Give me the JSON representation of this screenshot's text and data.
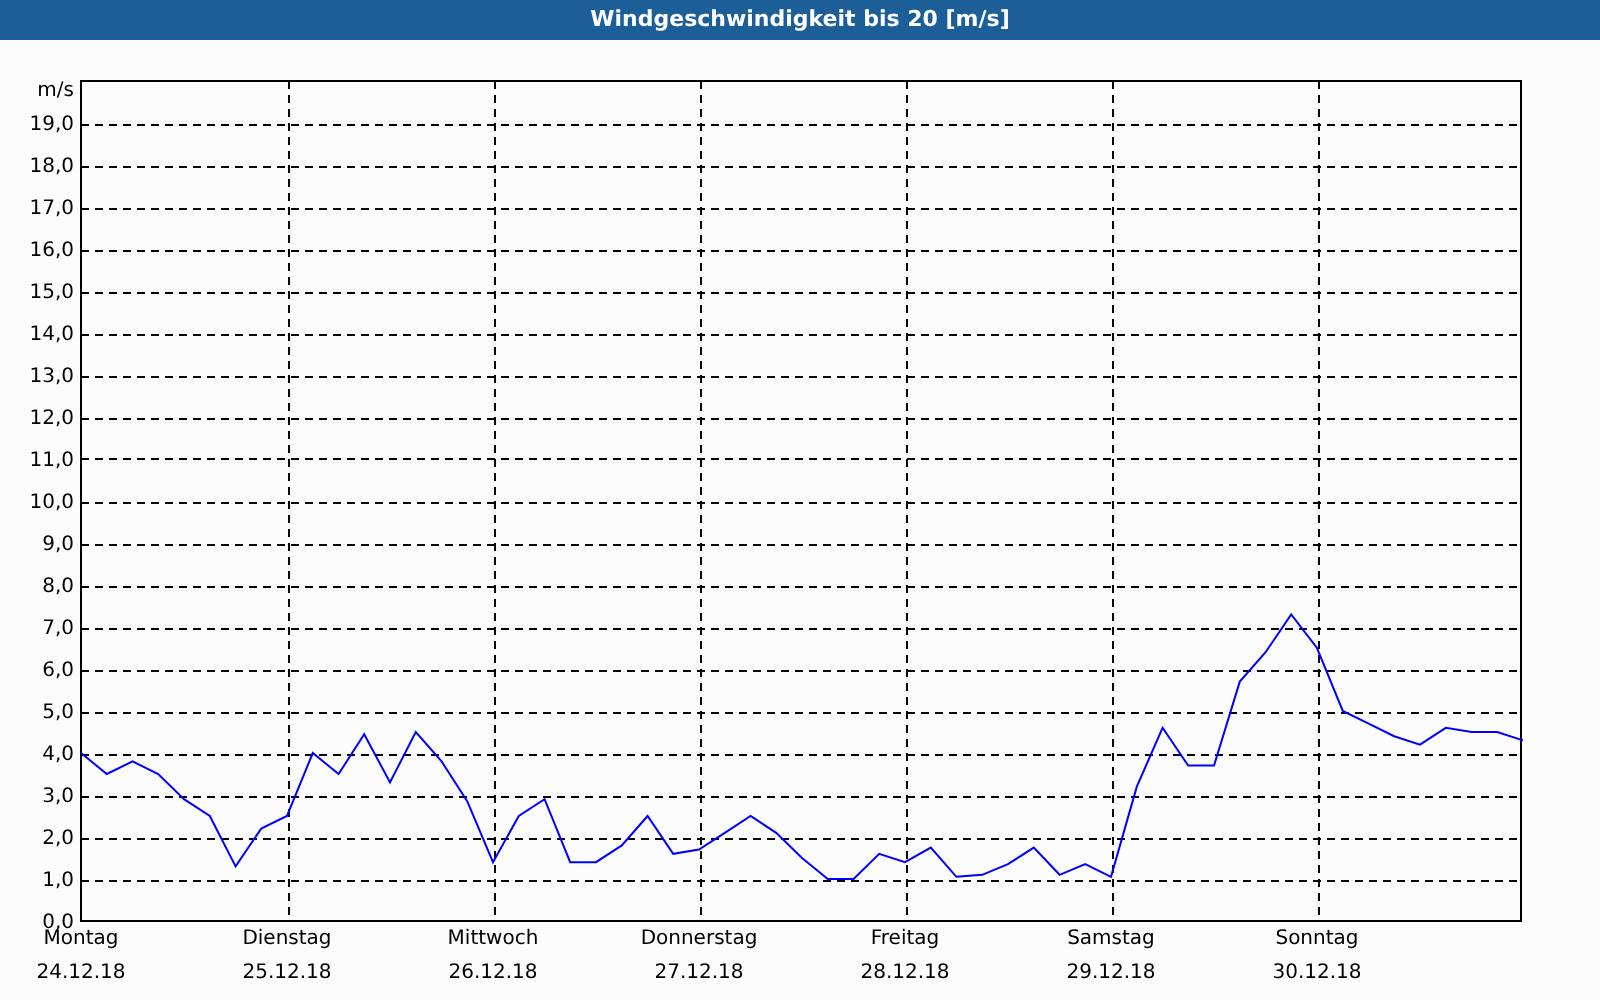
{
  "window": {
    "title": "Windgeschwindigkeit bis 20 [m/s]"
  },
  "chart": {
    "chart_data": {
      "type": "line",
      "grid": true,
      "ylabel": "m/s",
      "ylim": [
        0,
        20
      ],
      "categories": [
        "Montag",
        null,
        null,
        null,
        null,
        null,
        null,
        null,
        "Dienstag",
        null,
        null,
        null,
        null,
        null,
        null,
        null,
        "Mittwoch",
        null,
        null,
        null,
        null,
        null,
        null,
        null,
        "Donnerstag",
        null,
        null,
        null,
        null,
        null,
        null,
        null,
        "Freitag",
        null,
        null,
        null,
        null,
        null,
        null,
        null,
        "Samstag",
        null,
        null,
        null,
        null,
        null,
        null,
        null,
        "Sonntag",
        null,
        null,
        null,
        null,
        null,
        null,
        null,
        null
      ],
      "series": [
        {
          "color": "#0000ff",
          "values": [
            4.0,
            3.5,
            3.8,
            3.5,
            2.9,
            2.5,
            1.3,
            2.2,
            2.5,
            4.0,
            3.5,
            4.45,
            3.3,
            4.5,
            3.8,
            2.85,
            1.4,
            2.5,
            2.9,
            1.4,
            1.4,
            1.8,
            2.5,
            1.6,
            1.7,
            2.1,
            2.5,
            2.1,
            1.5,
            1.0,
            1.0,
            1.6,
            1.4,
            1.75,
            1.05,
            1.1,
            1.35,
            1.75,
            1.1,
            1.35,
            1.05,
            3.2,
            4.6,
            3.7,
            3.7,
            5.7,
            6.4,
            7.3,
            6.5,
            5.0,
            4.7,
            4.4,
            4.2,
            4.6,
            4.5,
            4.5,
            4.3
          ]
        }
      ],
      "yticks": [
        {
          "value": 0,
          "label": "0,0"
        },
        {
          "value": 1,
          "label": "1,0"
        },
        {
          "value": 2,
          "label": "2,0"
        },
        {
          "value": 3,
          "label": "3,0"
        },
        {
          "value": 4,
          "label": "4,0"
        },
        {
          "value": 5,
          "label": "5,0"
        },
        {
          "value": 6,
          "label": "6,0"
        },
        {
          "value": 7,
          "label": "7,0"
        },
        {
          "value": 8,
          "label": "8,0"
        },
        {
          "value": 9,
          "label": "9,0"
        },
        {
          "value": 10,
          "label": "10,0"
        },
        {
          "value": 11,
          "label": "11,0"
        },
        {
          "value": 12,
          "label": "12,0"
        },
        {
          "value": 13,
          "label": "13,0"
        },
        {
          "value": 14,
          "label": "14,0"
        },
        {
          "value": 15,
          "label": "15,0"
        },
        {
          "value": 16,
          "label": "16,0"
        },
        {
          "value": 17,
          "label": "17,0"
        },
        {
          "value": 18,
          "label": "18,0"
        },
        {
          "value": 19,
          "label": "19,0"
        }
      ]
    },
    "dates": [
      "24.12.18",
      "25.12.18",
      "26.12.18",
      "27.12.18",
      "28.12.18",
      "29.12.18",
      "30.12.18"
    ]
  }
}
